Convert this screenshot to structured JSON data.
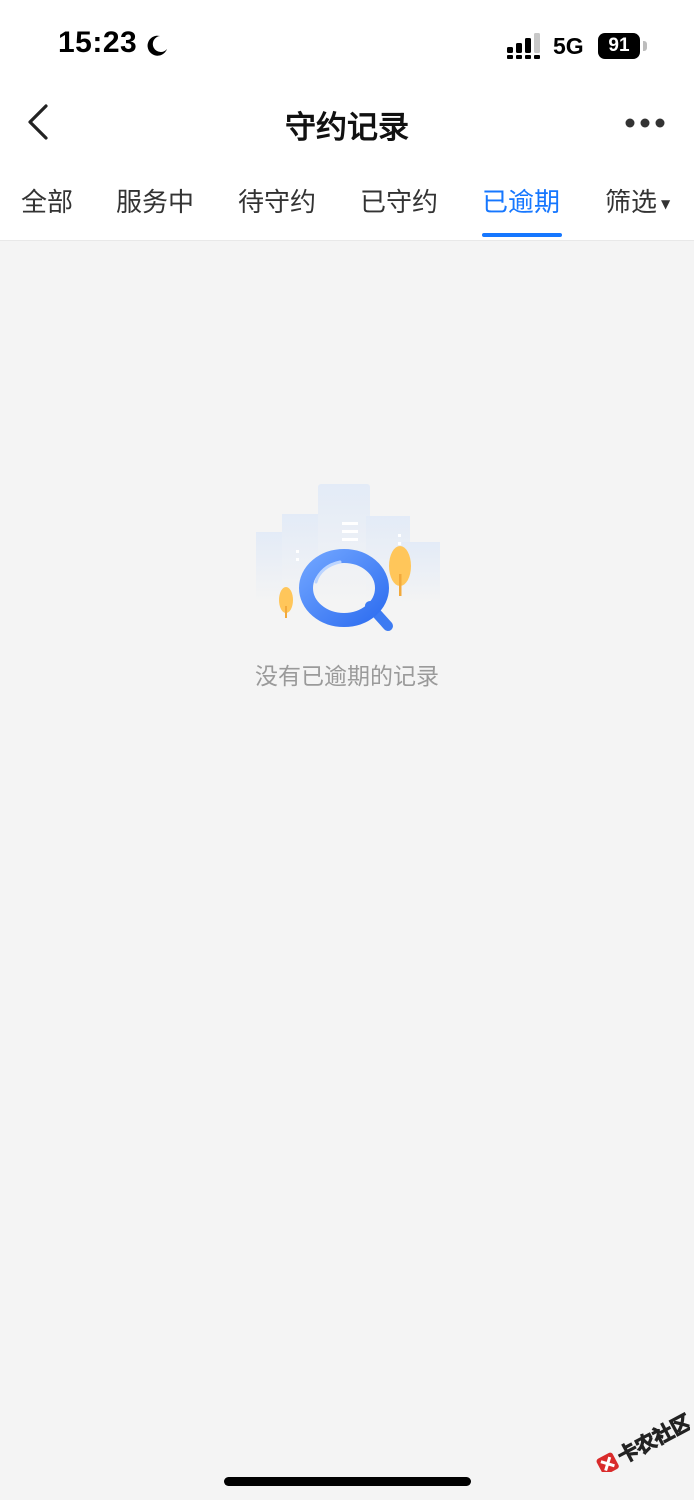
{
  "status_bar": {
    "time": "15:23",
    "network": "5G",
    "battery": "91",
    "icons": [
      "moon-icon",
      "signal-icon"
    ]
  },
  "nav": {
    "title": "守约记录",
    "back_icon": "chevron-left-icon",
    "more_icon": "more-dots-icon"
  },
  "tabs": [
    {
      "label": "全部",
      "active": false
    },
    {
      "label": "服务中",
      "active": false
    },
    {
      "label": "待守约",
      "active": false
    },
    {
      "label": "已守约",
      "active": false
    },
    {
      "label": "已逾期",
      "active": true
    },
    {
      "label": "筛选",
      "active": false,
      "has_dropdown": true
    }
  ],
  "empty_state": {
    "icon": "search-empty-illustration",
    "message": "没有已逾期的记录"
  },
  "watermark": {
    "text": "卡农社区"
  },
  "colors": {
    "accent": "#1677ff",
    "background": "#f4f4f4",
    "empty_text": "#9a9a9a"
  }
}
